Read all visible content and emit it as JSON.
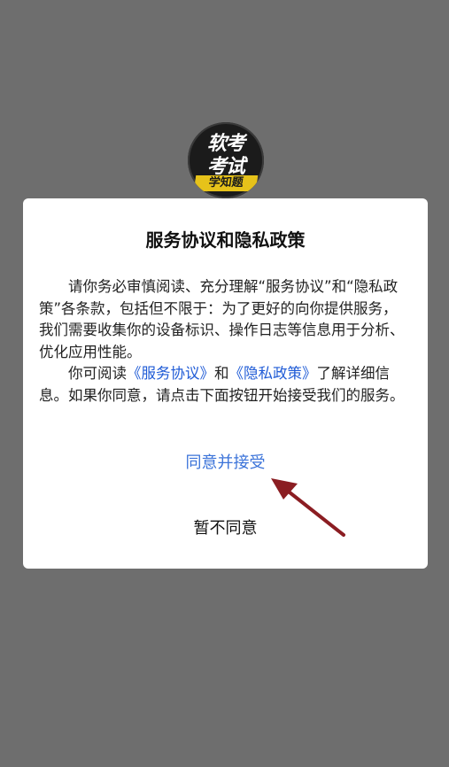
{
  "app_logo": {
    "line1": "软考",
    "line2": "考试",
    "band": "学知题",
    "colors": {
      "background": "#1b1b1b",
      "band": "#e6c21a"
    }
  },
  "dialog": {
    "title": "服务协议和隐私政策",
    "paragraph1": "请你务必审慎阅读、充分理解“服务协议”和“隐私政策”各条款，包括但不限于：为了更好的向你提供服务，我们需要收集你的设备标识、操作日志等信息用于分析、优化应用性能。",
    "paragraph2": {
      "prefix": "你可阅读",
      "link_service": "《服务协议》",
      "conjunction": "和",
      "link_privacy": "《隐私政策》",
      "suffix": "了解详细信息。如果你同意，请点击下面按钮开始接受我们的服务。"
    },
    "agree_label": "同意并接受",
    "disagree_label": "暂不同意"
  },
  "annotation": {
    "icon": "arrow-pointing-to-agree-icon",
    "color": "#8b1d22"
  },
  "colors": {
    "overlay": "#6e6e6e",
    "link": "#1f5bd6",
    "agree": "#3b73d9"
  }
}
